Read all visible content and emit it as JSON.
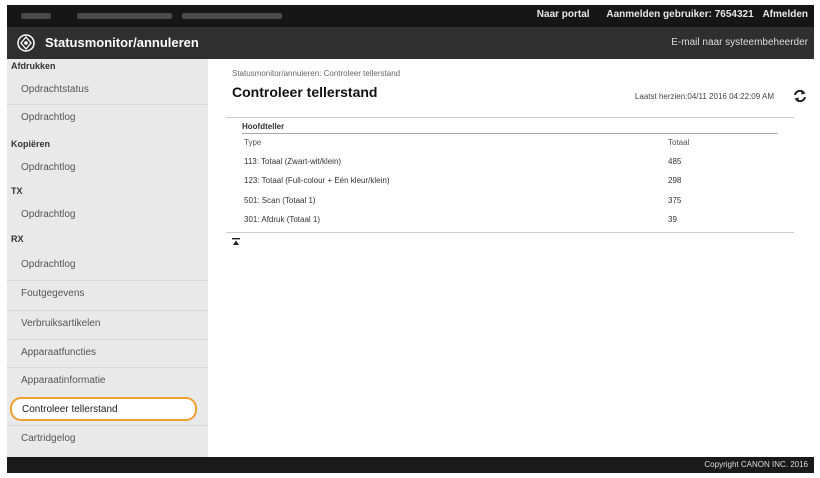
{
  "topbar": {
    "portal": "Naar portal",
    "login_label": "Aanmelden gebruiker: 7654321",
    "logout": "Afmelden"
  },
  "header": {
    "title": "Statusmonitor/annuleren",
    "email_link": "E-mail naar systeembeheerder"
  },
  "sidebar": {
    "sections": {
      "print": "Afdrukken",
      "copy": "Kopiëren",
      "tx": "TX",
      "rx": "RX"
    },
    "items": {
      "print_job_status": "Opdrachtstatus",
      "print_job_log": "Opdrachtlog",
      "copy_job_log": "Opdrachtlog",
      "tx_job_log": "Opdrachtlog",
      "rx_job_log": "Opdrachtlog",
      "error_info": "Foutgegevens",
      "consumables": "Verbruiksartikelen",
      "device_functions": "Apparaatfuncties",
      "device_info": "Apparaatinformatie",
      "check_counter": "Controleer tellerstand",
      "cartridge_log": "Cartridgelog"
    }
  },
  "main": {
    "breadcrumb": "Statusmonitor/annuleren: Controleer tellerstand",
    "title": "Controleer tellerstand",
    "last_updated": "Laatst herzien:04/11 2016 04:22:09 AM",
    "counter_heading": "Hoofdteller",
    "columns": {
      "type": "Type",
      "total": "Totaal"
    },
    "rows": [
      {
        "type": "113: Totaal (Zwart-wit/klein)",
        "total": "485"
      },
      {
        "type": "123: Totaal (Full-colour + Eén kleur/klein)",
        "total": "298"
      },
      {
        "type": "501: Scan (Totaal 1)",
        "total": "375"
      },
      {
        "type": "301: Afdruk (Totaal 1)",
        "total": "39"
      }
    ]
  },
  "footer": {
    "copyright": "Copyright CANON INC. 2016"
  }
}
